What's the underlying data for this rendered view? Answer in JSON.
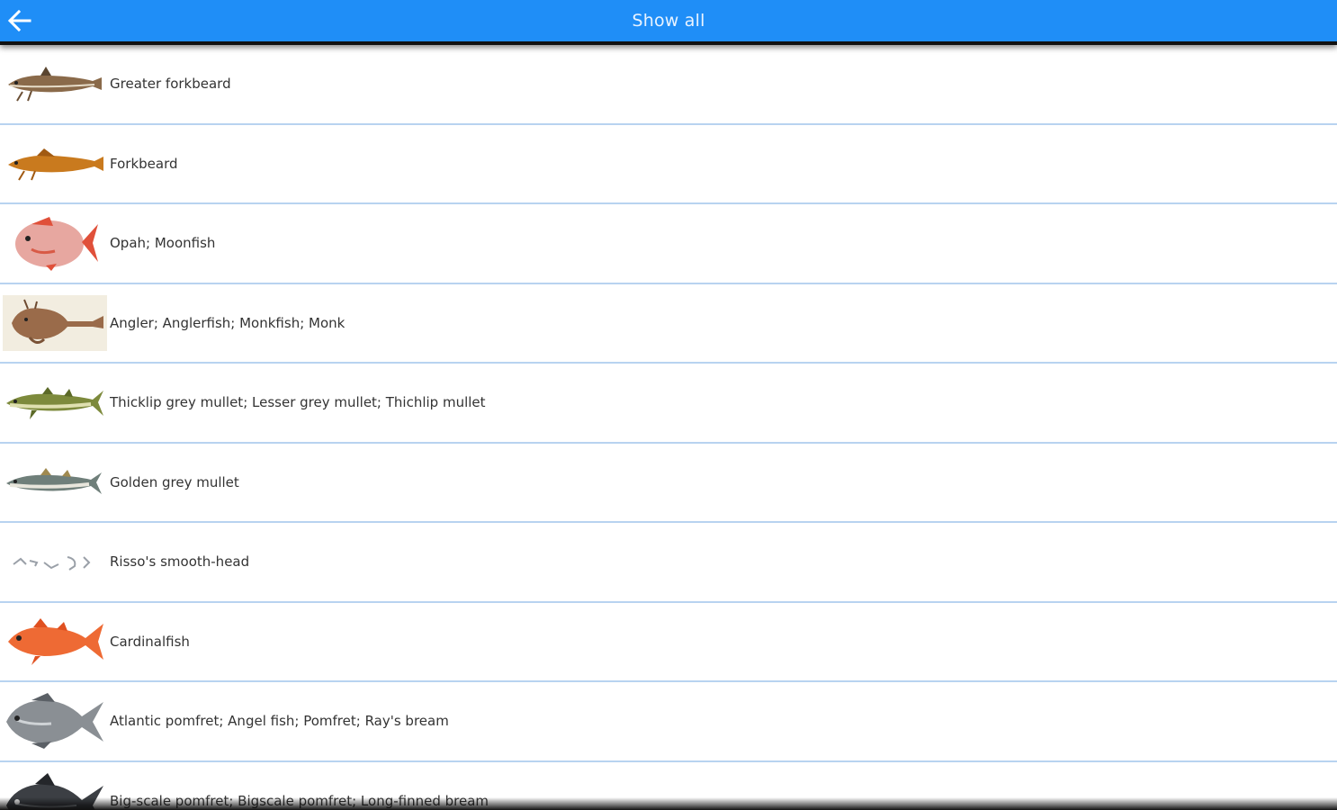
{
  "header": {
    "title": "Show all",
    "back_icon": "arrow-left-icon",
    "color": "#1f8ef7"
  },
  "fish_list": [
    {
      "name": "Greater forkbeard",
      "icon": "greater-forkbeard-fish-icon",
      "color": "#8a6a4a"
    },
    {
      "name": "Forkbeard",
      "icon": "forkbeard-fish-icon",
      "color": "#c97a1e"
    },
    {
      "name": "Opah; Moonfish",
      "icon": "opah-fish-icon",
      "color": "#d9776a"
    },
    {
      "name": "Angler; Anglerfish; Monkfish; Monk",
      "icon": "angler-fish-icon",
      "color": "#9a6b4a"
    },
    {
      "name": "Thicklip grey mullet; Lesser grey mullet; Thichlip mullet",
      "icon": "thicklip-mullet-fish-icon",
      "color": "#7d8a3c"
    },
    {
      "name": "Golden grey mullet",
      "icon": "golden-grey-mullet-fish-icon",
      "color": "#6f7f7a"
    },
    {
      "name": "Risso's smooth-head",
      "icon": "smooth-head-fish-icon",
      "color": "#9aa0a8"
    },
    {
      "name": "Cardinalfish",
      "icon": "cardinalfish-fish-icon",
      "color": "#ee6a34"
    },
    {
      "name": "Atlantic pomfret; Angel fish; Pomfret; Ray's bream",
      "icon": "atlantic-pomfret-fish-icon",
      "color": "#8a8f94"
    },
    {
      "name": "Big-scale pomfret; Bigscale pomfret; Long-finned bream",
      "icon": "bigscale-pomfret-fish-icon",
      "color": "#3c3f44"
    }
  ]
}
